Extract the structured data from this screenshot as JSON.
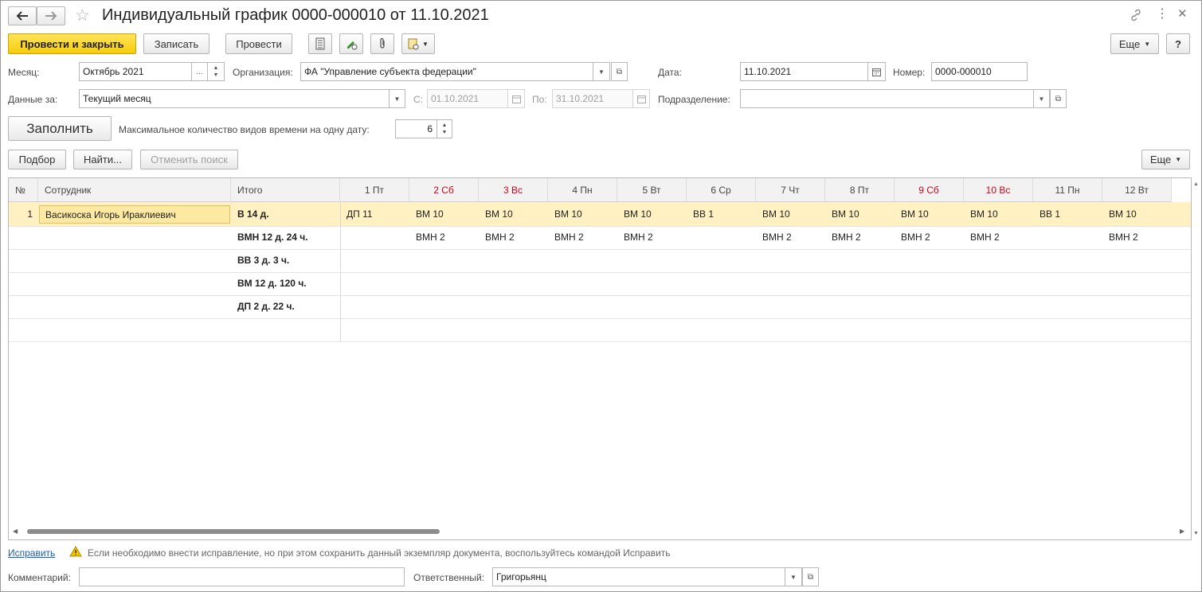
{
  "window": {
    "title": "Индивидуальный график 0000-000010 от 11.10.2021"
  },
  "toolbar": {
    "post_close": "Провести и закрыть",
    "save": "Записать",
    "post": "Провести",
    "more": "Еще",
    "help": "?"
  },
  "form": {
    "month_label": "Месяц:",
    "month_value": "Октябрь 2021",
    "month_dots": "...",
    "org_label": "Организация:",
    "org_value": "ФА \"Управление субъекта федерации\"",
    "date_label": "Дата:",
    "date_value": "11.10.2021",
    "number_label": "Номер:",
    "number_value": "0000-000010",
    "data_for_label": "Данные за:",
    "data_for_value": "Текущий месяц",
    "from_label": "С:",
    "from_value": "01.10.2021",
    "to_label": "По:",
    "to_value": "31.10.2021",
    "dept_label": "Подразделение:",
    "dept_value": "",
    "fill_button": "Заполнить",
    "max_label": "Максимальное количество видов времени на одну дату:",
    "max_value": "6"
  },
  "table_toolbar": {
    "pick": "Подбор",
    "find": "Найти...",
    "cancel_search": "Отменить поиск",
    "more": "Еще"
  },
  "table": {
    "col_num": "№",
    "col_employee": "Сотрудник",
    "col_total": "Итого",
    "days": [
      {
        "label": "1 Пт",
        "weekend": false
      },
      {
        "label": "2 Сб",
        "weekend": true
      },
      {
        "label": "3 Вс",
        "weekend": true
      },
      {
        "label": "4 Пн",
        "weekend": false
      },
      {
        "label": "5 Вт",
        "weekend": false
      },
      {
        "label": "6 Ср",
        "weekend": false
      },
      {
        "label": "7 Чт",
        "weekend": false
      },
      {
        "label": "8 Пт",
        "weekend": false
      },
      {
        "label": "9 Сб",
        "weekend": true
      },
      {
        "label": "10 Вс",
        "weekend": true
      },
      {
        "label": "11 Пн",
        "weekend": false
      },
      {
        "label": "12 Вт",
        "weekend": false
      }
    ],
    "row_num": "1",
    "employee": "Васикоска Игорь Ираклиевич",
    "totals": [
      "В 14 д.",
      "ВМН 12 д. 24 ч.",
      "ВВ 3 д. 3 ч.",
      "ВМ 12 д. 120 ч.",
      "ДП 2 д. 22 ч."
    ],
    "line1": [
      "ДП 11",
      "ВМ 10",
      "ВМ 10",
      "ВМ 10",
      "ВМ 10",
      "ВВ 1",
      "ВМ 10",
      "ВМ 10",
      "ВМ 10",
      "ВМ 10",
      "ВВ 1",
      "ВМ 10"
    ],
    "line2": [
      "",
      "ВМН 2",
      "ВМН 2",
      "ВМН 2",
      "ВМН 2",
      "",
      "ВМН 2",
      "ВМН 2",
      "ВМН 2",
      "ВМН 2",
      "",
      "ВМН 2"
    ]
  },
  "footer": {
    "fix_link": "Исправить",
    "fix_hint": "Если необходимо внести исправление, но при этом сохранить данный экземпляр документа, воспользуйтесь командой Исправить",
    "comment_label": "Комментарий:",
    "comment_value": "",
    "responsible_label": "Ответственный:",
    "responsible_value": "Григорьянц"
  },
  "colors": {
    "accent_yellow": "#f5cc0a",
    "selected_row": "#fff1c2",
    "weekend_red": "#d0021b",
    "link_blue": "#1a5fb4"
  }
}
